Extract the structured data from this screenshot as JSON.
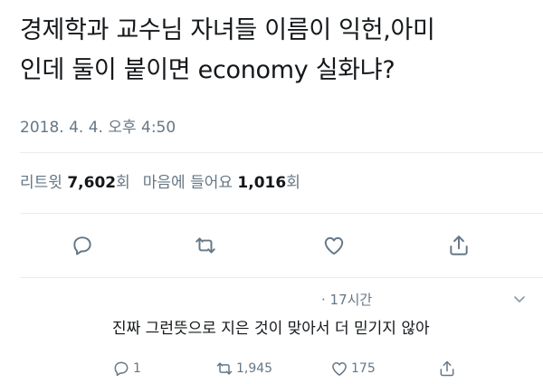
{
  "tweet": {
    "text_line1": "경제학과 교수님 자녀들 이름이 익헌,아미",
    "text_line2": "인데 둘이 붙이면 economy 실화냐?",
    "timestamp": "2018. 4. 4. 오후 4:50"
  },
  "stats": {
    "retweets_label": "리트윗",
    "retweets_count": "7,602",
    "retweets_suffix": "회",
    "likes_label": "마음에 들어요",
    "likes_count": "1,016",
    "likes_suffix": "회"
  },
  "actions": {
    "icons": [
      "reply-icon",
      "retweet-icon",
      "like-icon",
      "share-icon"
    ]
  },
  "reply": {
    "time": "· 17시간",
    "text": "진짜 그런뜻으로 지은 것이 맞아서 더 믿기지 않아",
    "reply_count": "1",
    "retweet_count": "1,945",
    "like_count": "175"
  },
  "colors": {
    "text": "#14171a",
    "secondary": "#657786",
    "divider": "#e6ecf0"
  }
}
